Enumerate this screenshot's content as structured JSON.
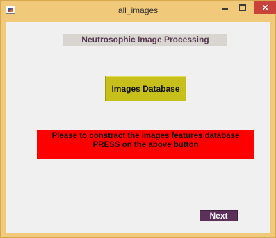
{
  "window": {
    "title": "all_images",
    "close_glyph": "✕"
  },
  "main": {
    "heading": "Neutrosophic Image Processing",
    "database_button_label": "Images Database",
    "message_line1": "Please to constract the images features database",
    "message_line2": "PRESS on the above button",
    "next_button_label": "Next"
  },
  "colors": {
    "window_frame": "#f0c97a",
    "client_background": "#f0f0f0",
    "heading_background": "#d9d6d2",
    "database_button": "#c7c01a",
    "message_background": "#ff0000",
    "next_button": "#5b315a",
    "close_button": "#c9433a"
  },
  "icons": {
    "app": "matlab-figure-icon",
    "minimize": "minimize-icon",
    "maximize": "maximize-icon",
    "close": "close-icon"
  }
}
